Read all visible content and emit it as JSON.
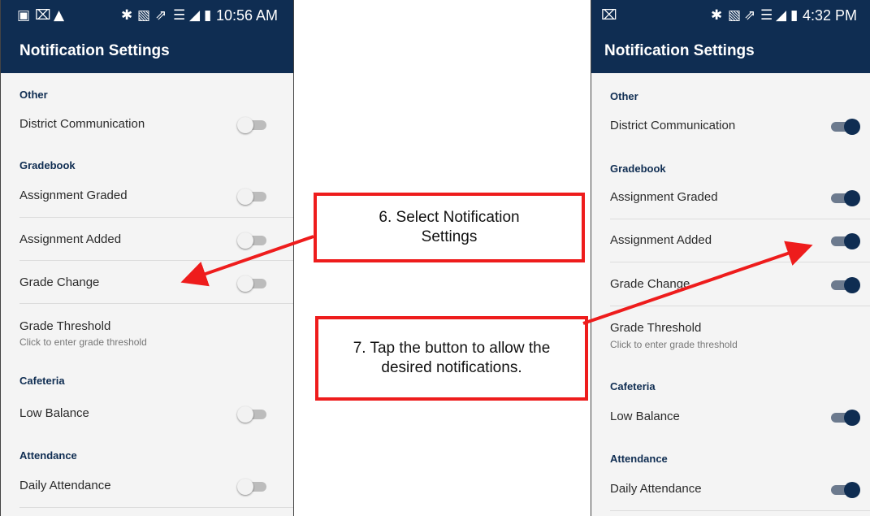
{
  "left_phone": {
    "status": {
      "icons": [
        "screenshot-icon",
        "close-box-icon",
        "warning-icon",
        "bluetooth-icon",
        "nfc-icon",
        "mute-icon",
        "wifi-icon",
        "signal-icon",
        "battery-icon"
      ],
      "time": "10:56 AM"
    },
    "title": "Notification Settings",
    "sections": [
      {
        "header": "Other",
        "rows": [
          {
            "label": "District Communication",
            "on": false
          }
        ]
      },
      {
        "header": "Gradebook",
        "rows": [
          {
            "label": "Assignment Graded",
            "on": false
          },
          {
            "label": "Assignment Added",
            "on": false
          },
          {
            "label": "Grade Change",
            "on": false
          },
          {
            "label": "Grade Threshold",
            "sub": "Click to enter grade threshold"
          }
        ]
      },
      {
        "header": "Cafeteria",
        "rows": [
          {
            "label": "Low Balance",
            "on": false
          }
        ]
      },
      {
        "header": "Attendance",
        "rows": [
          {
            "label": "Daily Attendance",
            "on": false
          }
        ]
      }
    ]
  },
  "right_phone": {
    "status": {
      "icons": [
        "close-box-icon",
        "bluetooth-icon",
        "nfc-icon",
        "mute-icon",
        "wifi-icon",
        "signal-icon",
        "battery-icon"
      ],
      "time": "4:32 PM"
    },
    "title": "Notification Settings",
    "sections": [
      {
        "header": "Other",
        "rows": [
          {
            "label": "District Communication",
            "on": true
          }
        ]
      },
      {
        "header": "Gradebook",
        "rows": [
          {
            "label": "Assignment Graded",
            "on": true
          },
          {
            "label": "Assignment Added",
            "on": true
          },
          {
            "label": "Grade Change",
            "on": true
          },
          {
            "label": "Grade Threshold",
            "sub": "Click to enter grade threshold"
          }
        ]
      },
      {
        "header": "Cafeteria",
        "rows": [
          {
            "label": "Low Balance",
            "on": true
          }
        ]
      },
      {
        "header": "Attendance",
        "rows": [
          {
            "label": "Daily Attendance",
            "on": true
          }
        ]
      }
    ]
  },
  "callouts": {
    "step6": "6. Select Notification Settings",
    "step7": "7. Tap the button to allow the desired notifications."
  },
  "colors": {
    "navy": "#0f2d52",
    "callout_red": "#ee1c1c",
    "toggle_off": "#bcbcbc"
  }
}
